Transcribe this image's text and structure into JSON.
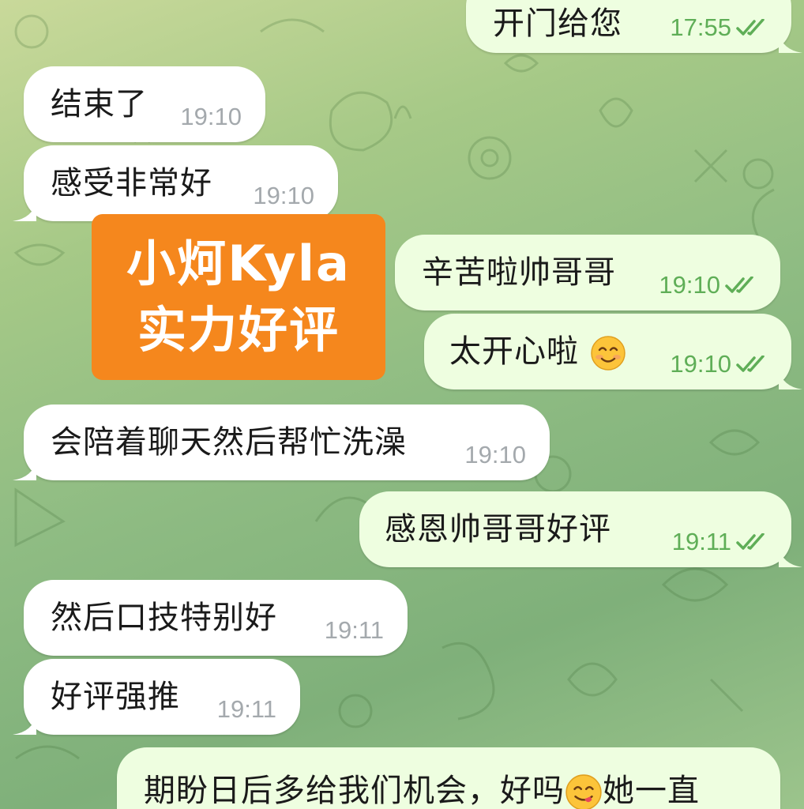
{
  "messages": [
    {
      "id": "m1",
      "dir": "out",
      "text": "开门给您",
      "time": "17:55",
      "read": true
    },
    {
      "id": "m2",
      "dir": "in",
      "text": "结束了",
      "time": "19:10"
    },
    {
      "id": "m3",
      "dir": "in",
      "text": "感受非常好",
      "time": "19:10"
    },
    {
      "id": "m4",
      "dir": "out",
      "text": "辛苦啦帅哥哥",
      "time": "19:10",
      "read": true
    },
    {
      "id": "m5",
      "dir": "out",
      "text": "太开心啦",
      "emoji": "smiling-face-icon",
      "time": "19:10",
      "read": true
    },
    {
      "id": "m6",
      "dir": "in",
      "text": "会陪着聊天然后帮忙洗澡",
      "time": "19:10"
    },
    {
      "id": "m7",
      "dir": "out",
      "text": "感恩帅哥哥好评",
      "time": "19:11",
      "read": true
    },
    {
      "id": "m8",
      "dir": "in",
      "text": "然后口技特别好",
      "time": "19:11"
    },
    {
      "id": "m9",
      "dir": "in",
      "text": "好评强推",
      "time": "19:11"
    },
    {
      "id": "m10",
      "dir": "out",
      "text_before_emoji": "期盼日后多给我们机会，好吗",
      "emoji": "yum-face-icon",
      "text_after_emoji": "她一直"
    }
  ],
  "promo": {
    "line1": "小炣Kyla",
    "line2": "实力好评",
    "color": "#f5871d"
  },
  "colors": {
    "incoming_bubble": "#ffffff",
    "outgoing_bubble": "#eefee0",
    "incoming_time": "#a4a9ad",
    "outgoing_time": "#5fae57"
  }
}
